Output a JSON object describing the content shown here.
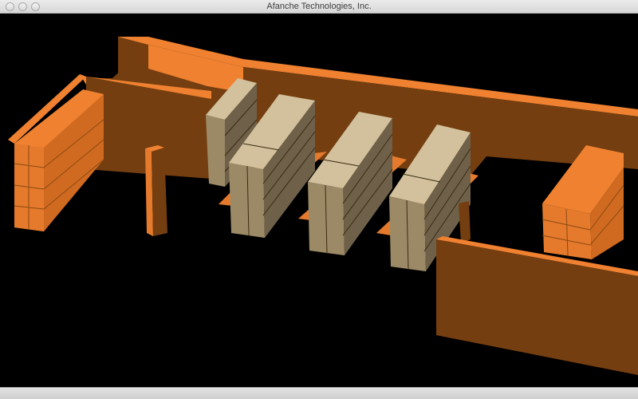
{
  "window": {
    "title": "Afanche Technologies, Inc.",
    "controls": [
      "close-button",
      "minimize-button",
      "zoom-button"
    ]
  },
  "scene": {
    "background": "#000000",
    "colors": {
      "wall_light": "#ef8130",
      "wall_dark": "#743e10",
      "shelf_front": "#e57a2c",
      "rack_top": "#d2c19c",
      "rack_side": "#6f6049",
      "rack_front": "#9c8a67",
      "rack_lines": "#3a2a12"
    }
  }
}
